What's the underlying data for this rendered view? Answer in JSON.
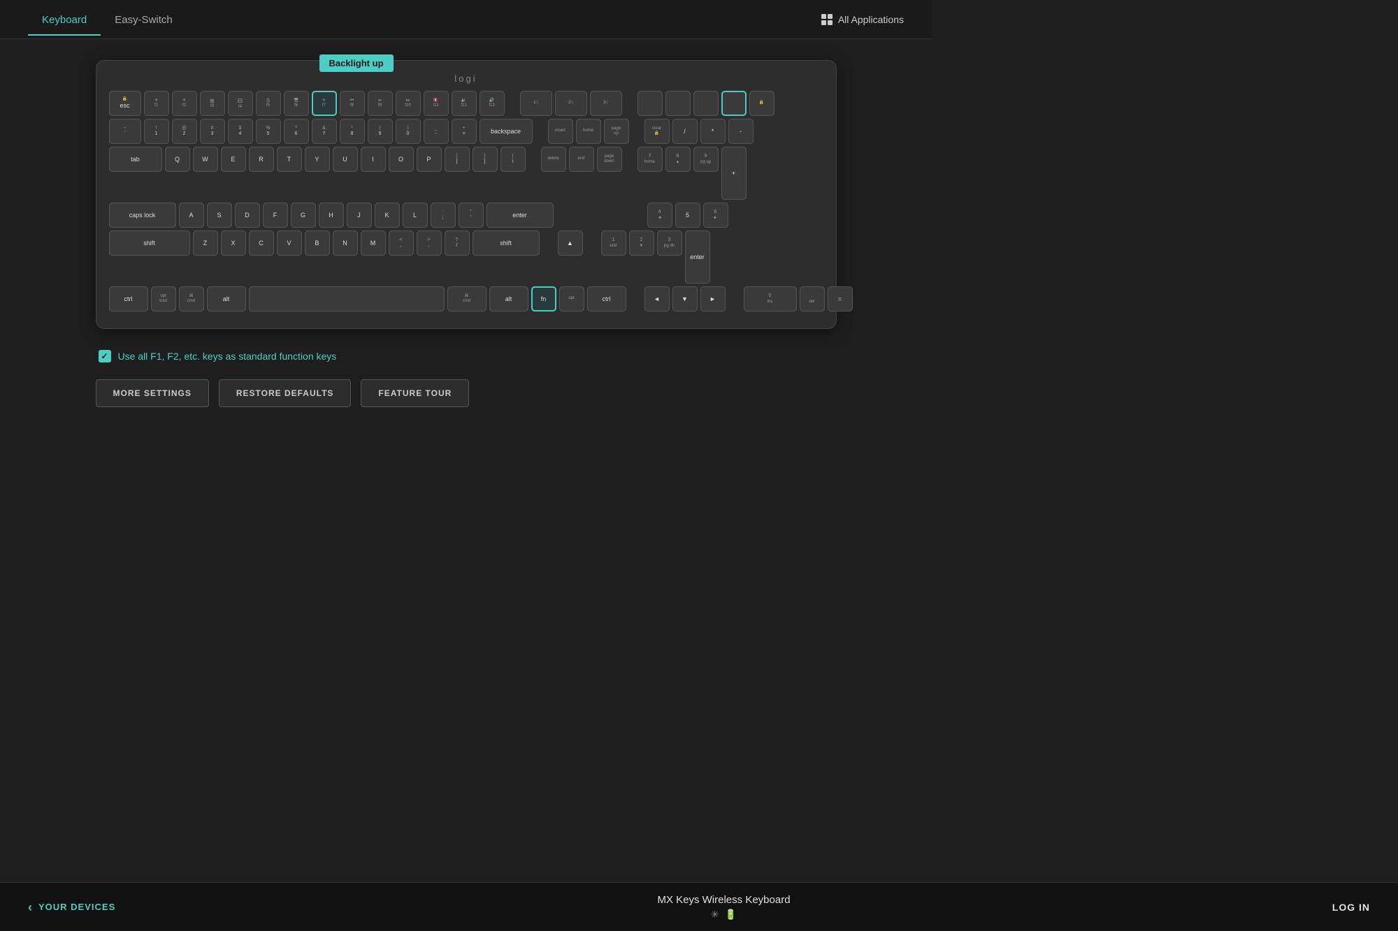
{
  "header": {
    "tab_keyboard": "Keyboard",
    "tab_easyswitch": "Easy-Switch",
    "all_applications_label": "All Applications"
  },
  "tooltip": {
    "text": "Backlight up"
  },
  "keyboard": {
    "brand": "logi"
  },
  "settings": {
    "checkbox_label": "Use all F1, F2, etc. keys as standard function keys",
    "btn_more_settings": "MORE SETTINGS",
    "btn_restore_defaults": "RESTORE DEFAULTS",
    "btn_feature_tour": "FEATURE TOUR"
  },
  "footer": {
    "your_devices_label": "YOUR DEVICES",
    "device_name": "MX Keys Wireless Keyboard",
    "log_in_label": "LOG IN"
  }
}
